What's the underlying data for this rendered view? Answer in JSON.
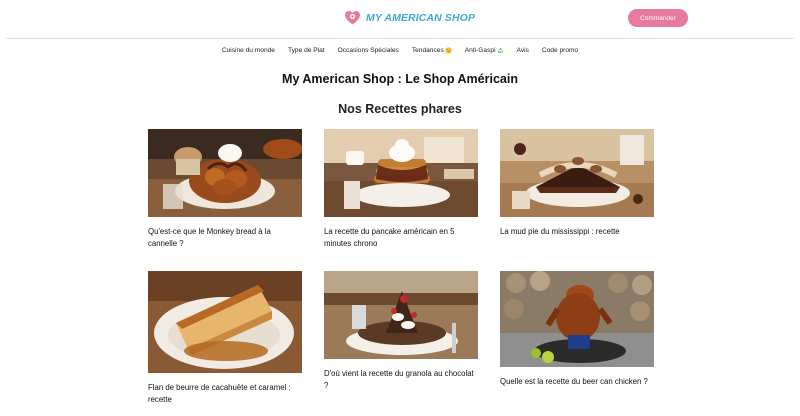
{
  "brand": {
    "name": "MY AMERICAN SHOP",
    "accent": "#3fa9d6",
    "pink": "#e77a9d"
  },
  "header": {
    "cta_label": "Commander"
  },
  "nav": {
    "items": [
      {
        "label": "Cuisine du monde"
      },
      {
        "label": "Type de Plat"
      },
      {
        "label": "Occasions Spéciales"
      },
      {
        "label": "Tendances",
        "icon": "heart-eyes-emoji"
      },
      {
        "label": "Anti-Gaspi",
        "icon": "recycle-emoji"
      },
      {
        "label": "Avis"
      },
      {
        "label": "Code promo"
      }
    ]
  },
  "page": {
    "title": "My American Shop : Le Shop Américain",
    "section_title": "Nos Recettes phares"
  },
  "recipes": [
    {
      "title": "Qu'est-ce que le Monkey bread à la cannelle ?",
      "image": "monkey-bread-photo"
    },
    {
      "title": "La recette du pancake américain en 5 minutes chrono",
      "image": "pancake-photo"
    },
    {
      "title": "La mud pie du mississippi : recette",
      "image": "mud-pie-photo"
    },
    {
      "title": "Flan de beurre de cacahuète et caramel : recette",
      "image": "flan-photo"
    },
    {
      "title": "D'où vient la recette du granola au chocolat ?",
      "image": "granola-photo"
    },
    {
      "title": "Quelle est la recette du beer can chicken ?",
      "image": "beer-can-chicken-photo"
    }
  ]
}
